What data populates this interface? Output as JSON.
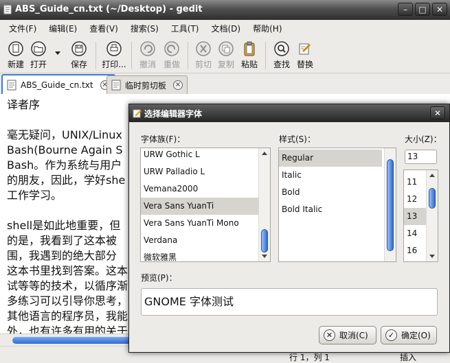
{
  "window": {
    "title": "ABS_Guide_cn.txt (~/Desktop) - gedit"
  },
  "menu": [
    "文件(F)",
    "编辑(E)",
    "查看(V)",
    "搜索(S)",
    "工具(T)",
    "文档(D)",
    "帮助(H)"
  ],
  "toolbar": {
    "new": "新建",
    "open": "打开",
    "save": "保存",
    "print": "打印...",
    "undo": "撤消",
    "redo": "重做",
    "cut": "剪切",
    "copy": "复制",
    "paste": "粘贴",
    "find": "查找",
    "replace": "替换"
  },
  "tabs": [
    {
      "label": "ABS_Guide_cn.txt",
      "close": "×"
    },
    {
      "label": "临时剪切板",
      "close": "×"
    }
  ],
  "editor": {
    "lines": [
      "译者序",
      "",
      "毫无疑问，UNIX/Linux",
      "Bash(Bourne Again S",
      "Bash。作为系统与用户",
      "的朋友，因此，学好she",
      "工作学习。",
      "",
      "shell是如此地重要，但",
      "的是，我看到了这本被",
      "围，我遇到的绝大部分",
      "这本书里找到答案。这本",
      "试等等的技术，以循序渐",
      "多练习可以引导你思考，",
      "其他语言的程序员，我能",
      "外，也有许多有用的关于"
    ]
  },
  "status": {
    "position": "行 1，列 1",
    "mode": "插入"
  },
  "dialog": {
    "title": "选择编辑器字体",
    "close": "✕",
    "family_label": "字体族(F)：",
    "style_label": "样式(S)：",
    "size_label": "大小(Z)：",
    "families": [
      "URW Gothic L",
      "URW Palladio L",
      "Vemana2000",
      "Vera Sans YuanTi",
      "Vera Sans YuanTi Mono",
      "Verdana",
      "微软雅黑"
    ],
    "family_selected": "Vera Sans YuanTi",
    "styles": [
      "Regular",
      "Italic",
      "Bold",
      "Bold Italic"
    ],
    "style_selected": "Regular",
    "size_value": "13",
    "sizes": [
      "11",
      "12",
      "13",
      "14",
      "16"
    ],
    "size_selected": "13",
    "preview_label": "预览(P)：",
    "preview_text": "GNOME 字体测试",
    "cancel": "取消(C)",
    "ok": "确定(O)"
  },
  "colors": {
    "accent": "#2f6bd2",
    "titlebar": "#2e2e2e",
    "selection": "#d6d4cf"
  }
}
